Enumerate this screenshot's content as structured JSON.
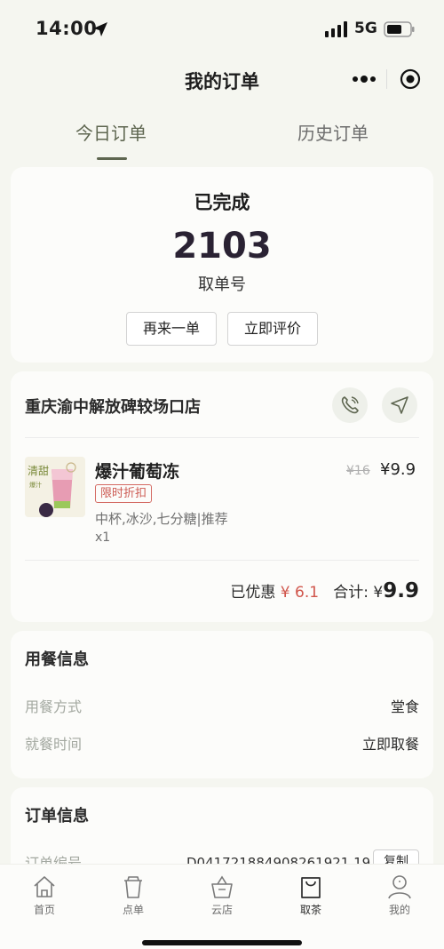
{
  "status_bar": {
    "time": "14:00",
    "network": "5G"
  },
  "nav": {
    "title": "我的订单"
  },
  "tabs": [
    {
      "label": "今日订单",
      "active": true
    },
    {
      "label": "历史订单",
      "active": false
    }
  ],
  "order_status": {
    "status": "已完成",
    "pickup_number": "2103",
    "pickup_label": "取单号",
    "reorder_label": "再来一单",
    "review_label": "立即评价"
  },
  "store": {
    "name": "重庆渝中解放碑较场口店",
    "item": {
      "name": "爆汁葡萄冻",
      "promo_tag": "限时折扣",
      "specs": "中杯,冰沙,七分糖|推荐",
      "quantity": "x1",
      "original_price": "¥16",
      "price": "¥9.9",
      "image_text_top": "清甜",
      "image_text_bottom": "爆汁"
    },
    "discount_label": "已优惠",
    "discount_value": "¥ 6.1",
    "total_label": "合计:",
    "total_currency": "¥",
    "total_value": "9.9"
  },
  "dining": {
    "title": "用餐信息",
    "rows": [
      {
        "label": "用餐方式",
        "value": "堂食"
      },
      {
        "label": "就餐时间",
        "value": "立即取餐"
      }
    ]
  },
  "order_info": {
    "title": "订单信息",
    "order_no_label": "订单编号",
    "order_no": "D041721884908261921 19",
    "copy_label": "复制"
  },
  "tab_bar": [
    {
      "label": "首页",
      "icon": "home-icon"
    },
    {
      "label": "点单",
      "icon": "cup-icon"
    },
    {
      "label": "云店",
      "icon": "basket-icon"
    },
    {
      "label": "取茶",
      "icon": "bag-icon",
      "active": true
    },
    {
      "label": "我的",
      "icon": "profile-icon"
    }
  ],
  "colors": {
    "accent": "#5e6650",
    "discount": "#d0554b",
    "background": "#f5f6f0"
  }
}
